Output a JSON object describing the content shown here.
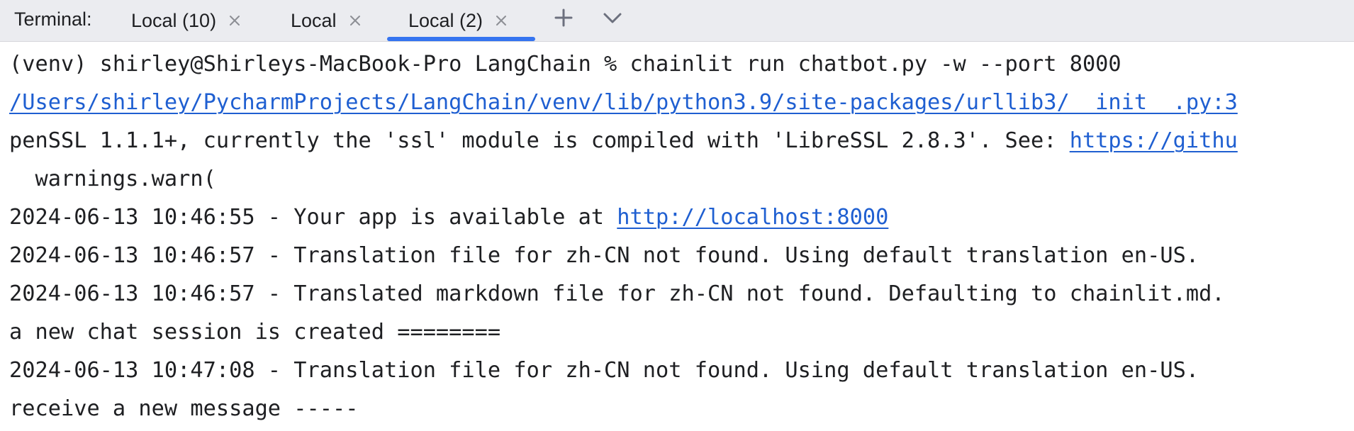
{
  "tool_window": {
    "label": "Terminal:"
  },
  "tabs": [
    {
      "label": "Local (10)",
      "active": false
    },
    {
      "label": "Local",
      "active": false
    },
    {
      "label": "Local (2)",
      "active": true
    }
  ],
  "toolbar": {
    "new_tab_icon": "plus-icon",
    "more_icon": "chevron-down-icon"
  },
  "colors": {
    "accent": "#3574f0",
    "link": "#1f5fd1",
    "tabbar_bg": "#ebecf0",
    "text": "#1e1f22"
  },
  "terminal": {
    "lines": [
      {
        "text": "(venv) shirley@Shirleys-MacBook-Pro LangChain % chainlit run chatbot.py -w --port 8000"
      },
      {
        "link": "/Users/shirley/PycharmProjects/LangChain/venv/lib/python3.9/site-packages/urllib3/__init__.py:3"
      },
      {
        "text": "penSSL 1.1.1+, currently the 'ssl' module is compiled with 'LibreSSL 2.8.3'. See: ",
        "link": "https://githu"
      },
      {
        "text": "  warnings.warn("
      },
      {
        "text": "2024-06-13 10:46:55 - Your app is available at ",
        "link": "http://localhost:8000"
      },
      {
        "text": "2024-06-13 10:46:57 - Translation file for zh-CN not found. Using default translation en-US."
      },
      {
        "text": "2024-06-13 10:46:57 - Translated markdown file for zh-CN not found. Defaulting to chainlit.md."
      },
      {
        "text": "a new chat session is created ========"
      },
      {
        "text": "2024-06-13 10:47:08 - Translation file for zh-CN not found. Using default translation en-US."
      },
      {
        "text": "receive a new message -----"
      }
    ]
  }
}
